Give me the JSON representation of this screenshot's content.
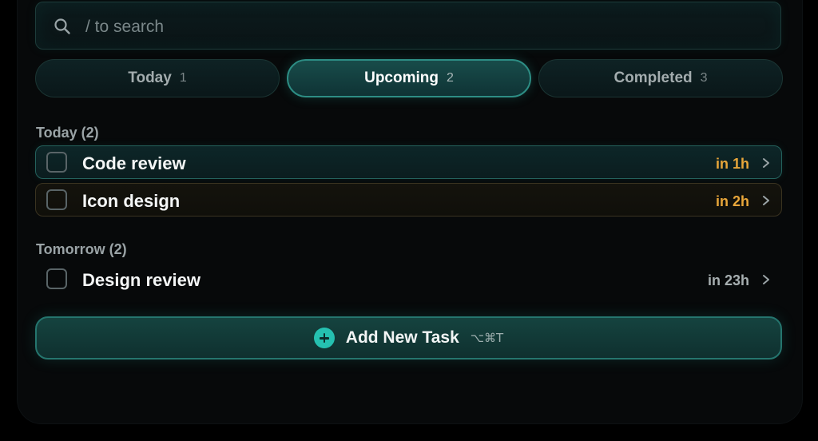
{
  "search": {
    "placeholder": "/ to search",
    "value": "",
    "icon": "search-icon"
  },
  "tabs": [
    {
      "label": "Today",
      "count": "1",
      "active": false
    },
    {
      "label": "Upcoming",
      "count": "2",
      "active": true
    },
    {
      "label": "Completed",
      "count": "3",
      "active": false
    }
  ],
  "sections": [
    {
      "label": "Today (2)",
      "tasks": [
        {
          "name": "Code review",
          "due": "in 1h",
          "due_color": "#e8a63a",
          "style": "teal"
        },
        {
          "name": "Icon design",
          "due": "in 2h",
          "due_color": "#e8a63a",
          "style": "amber"
        }
      ]
    },
    {
      "label": "Tomorrow (2)",
      "tasks": [
        {
          "name": "Design review",
          "due": "in 23h",
          "due_color": "#a6aeb0",
          "style": "plain"
        }
      ]
    }
  ],
  "add_task": {
    "label": "Add New Task",
    "shortcut": "⌥⌘T",
    "icon": "plus-circle-icon"
  },
  "colors": {
    "accent": "#25c0b0",
    "warning": "#e8a63a",
    "background": "#07090a"
  }
}
